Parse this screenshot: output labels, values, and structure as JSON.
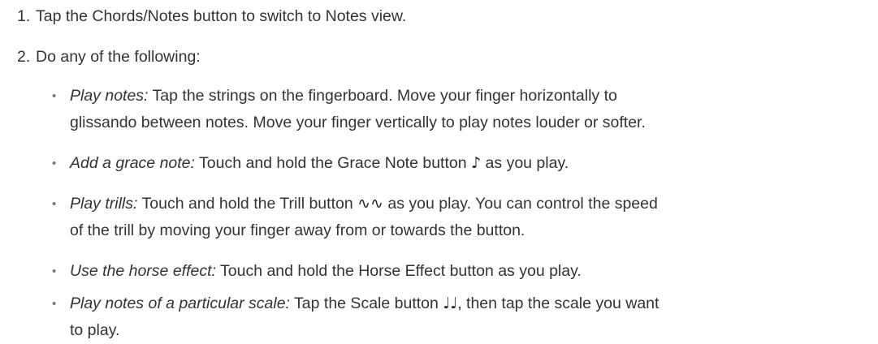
{
  "steps": [
    {
      "number": "1.",
      "text": "Tap the Chords/Notes button to switch to Notes view."
    },
    {
      "number": "2.",
      "text": "Do any of the following:"
    }
  ],
  "bullets": [
    {
      "term": "Play notes:",
      "line1": " Tap the strings on the fingerboard. Move your finger horizontally to",
      "line2": "glissando between notes. Move your finger vertically to play notes louder or softer."
    },
    {
      "term": "Add a grace note:",
      "before_icon": " Touch and hold the Grace Note button ",
      "icon": "grace-note-icon",
      "icon_glyph": "♪",
      "after_icon": " as you play."
    },
    {
      "term": "Play trills:",
      "before_icon": " Touch and hold the Trill button ",
      "icon": "trill-icon",
      "icon_glyph": "∿∿",
      "after_icon": " as you play. You can control the speed",
      "line2": "of the trill by moving your finger away from or towards the button."
    },
    {
      "term": "Use the horse effect:",
      "line1": " Touch and hold the Horse Effect button as you play."
    },
    {
      "term": "Play notes of a particular scale:",
      "before_icon": " Tap the Scale button ",
      "icon": "scale-icon",
      "icon_glyph": "♩♩",
      "after_icon": ", then tap the scale you want",
      "line2": "to play."
    }
  ]
}
